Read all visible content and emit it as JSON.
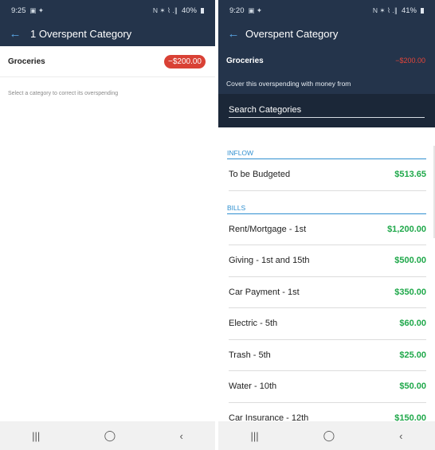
{
  "left": {
    "status": {
      "time": "9:25",
      "icons_left": "▣ ✦",
      "icons_right": "N ✶ ⌇ .∥",
      "battery": "40%"
    },
    "title": "1 Overspent Category",
    "category": {
      "name": "Groceries",
      "amount": "−$200.00"
    },
    "hint": "Select a category to correct its overspending"
  },
  "right": {
    "status": {
      "time": "9:20",
      "icons_left": "▣ ✦",
      "icons_right": "N ✶ ⌇ .∥",
      "battery": "41%"
    },
    "title": "Overspent Category",
    "category": {
      "name": "Groceries",
      "amount": "−$200.00"
    },
    "cover_text": "Cover this overspending with money from",
    "search_placeholder": "Search Categories",
    "sections": [
      {
        "header": "INFLOW",
        "items": [
          {
            "name": "To be Budgeted",
            "amount": "$513.65"
          }
        ]
      },
      {
        "header": "BILLS",
        "items": [
          {
            "name": "Rent/Mortgage - 1st",
            "amount": "$1,200.00"
          },
          {
            "name": "Giving - 1st and 15th",
            "amount": "$500.00"
          },
          {
            "name": "Car Payment - 1st",
            "amount": "$350.00"
          },
          {
            "name": "Electric - 5th",
            "amount": "$60.00"
          },
          {
            "name": "Trash - 5th",
            "amount": "$25.00"
          },
          {
            "name": "Water - 10th",
            "amount": "$50.00"
          },
          {
            "name": "Car Insurance - 12th",
            "amount": "$150.00"
          }
        ]
      }
    ]
  },
  "navbar": {
    "recents": "|||",
    "home": "◯",
    "back": "‹"
  },
  "icons": {
    "back": "arrow-left-icon",
    "recents": "recents-icon",
    "home": "home-icon",
    "nav_back": "chevron-left-icon"
  },
  "colors": {
    "header": "#24344b",
    "accent": "#2f8fd0",
    "negative": "#d94135",
    "positive": "#1fa84a"
  }
}
